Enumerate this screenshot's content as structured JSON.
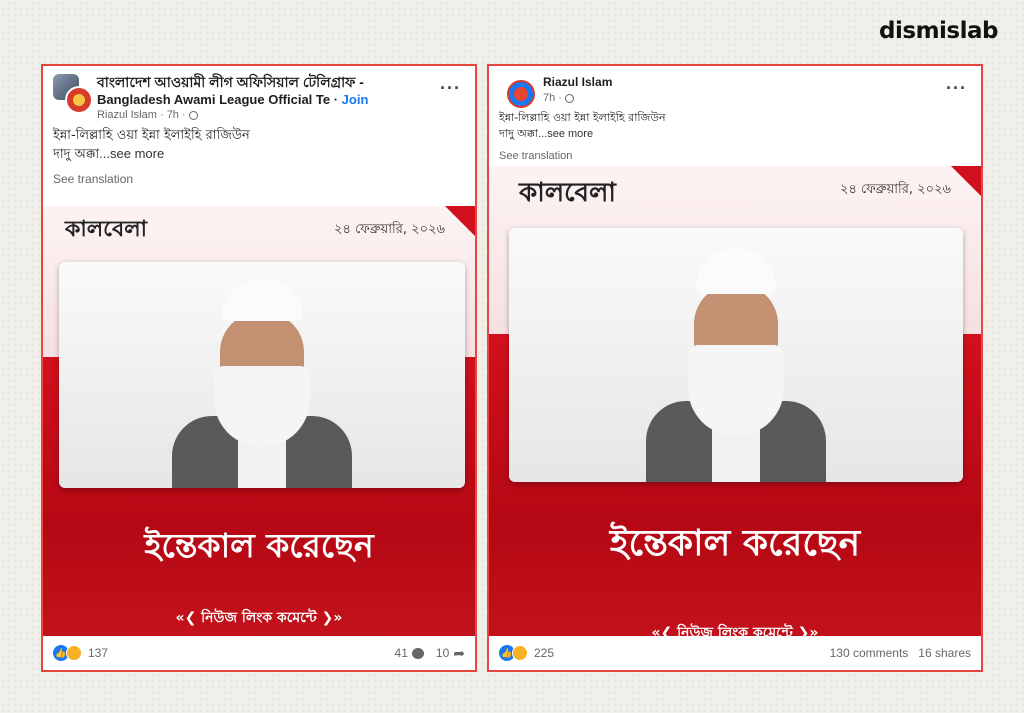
{
  "brand": "dismislab",
  "posts": [
    {
      "group_title": "বাংলাদেশ আওয়ামী লীগ অফিসিয়াল টেলিগ্রাফ -",
      "group_subtitle": "Bangladesh Awami League Official Te",
      "join_label": "Join",
      "author": "Riazul Islam",
      "time": "7h",
      "text_line1": "ইন্না-লিল্লাহি ওয়া ইন্না ইলাইহি  রাজিউন",
      "text_line2": "দাদু অক্কা",
      "see_more": "...see more",
      "see_translation": "See translation",
      "image": {
        "logo": "কালবেলা",
        "date": "২৪ ফেব্রুয়ারি, ২০২৬",
        "headline": "ইন্তেকাল করেছেন",
        "tagline": "«❮ নিউজ লিংক কমেন্টে ❯»"
      },
      "reactions_count": "137",
      "comments_count": "41",
      "shares_count": "10"
    },
    {
      "author": "Riazul Islam",
      "time": "7h",
      "text_line1": "ইন্না-লিল্লাহি ওয়া ইন্না ইলাইহি  রাজিউন",
      "text_line2": "দাদু অক্কা",
      "see_more": "...see more",
      "see_translation": "See translation",
      "image": {
        "logo": "কালবেলা",
        "date": "২৪ ফেব্রুয়ারি, ২০২৬",
        "headline": "ইন্তেকাল করেছেন",
        "tagline": "«❮ নিউজ লিংক কমেন্টে ❯»"
      },
      "reactions_count": "225",
      "comments_label": "130 comments",
      "shares_label": "16 shares"
    }
  ],
  "colors": {
    "highlight_border": "#e8473f",
    "news_red": "#d2101d",
    "fb_blue": "#1877f2"
  }
}
